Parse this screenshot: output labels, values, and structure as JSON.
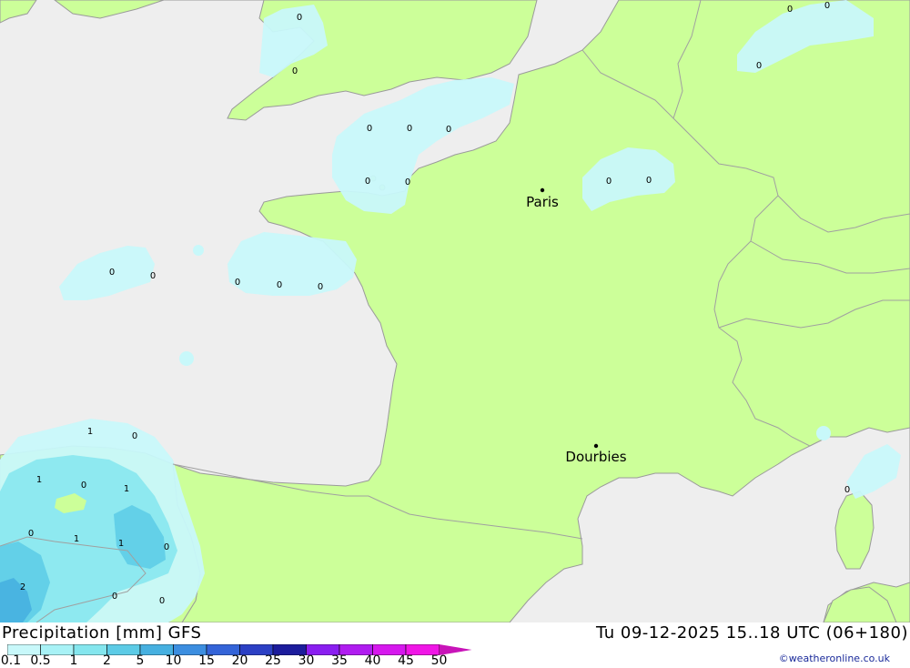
{
  "map": {
    "cities": [
      {
        "name": "Paris"
      },
      {
        "name": "Dourbies"
      }
    ],
    "values": [
      "0",
      "0",
      "0",
      "0",
      "0",
      "0",
      "0",
      "0",
      "0",
      "0",
      "0",
      "0",
      "0",
      "0",
      "0",
      "0",
      "0",
      "0",
      "1",
      "0",
      "1",
      "0",
      "1",
      "0",
      "1",
      "1",
      "2",
      "0",
      "0",
      "0"
    ]
  },
  "footer": {
    "title": "Precipitation [mm] GFS",
    "timestamp": "Tu 09-12-2025 15..18 UTC (06+180)",
    "credit": "©weatheronline.co.uk"
  },
  "legend": {
    "labels": [
      "0.1",
      "0.5",
      "1",
      "2",
      "5",
      "10",
      "15",
      "20",
      "25",
      "30",
      "35",
      "40",
      "45",
      "50"
    ],
    "colors": [
      "#c8f8fa",
      "#a8f2f6",
      "#84e6ee",
      "#5ccbe6",
      "#46b0e0",
      "#3c8ee0",
      "#3464d8",
      "#2c40c4",
      "#1c1c9c",
      "#8a1ef0",
      "#b01cf0",
      "#d618ee",
      "#f016e6",
      "#c814b8"
    ],
    "land_color": "#ccff99",
    "sea_color": "#eeeeee",
    "border_color": "#a0a0a0"
  }
}
